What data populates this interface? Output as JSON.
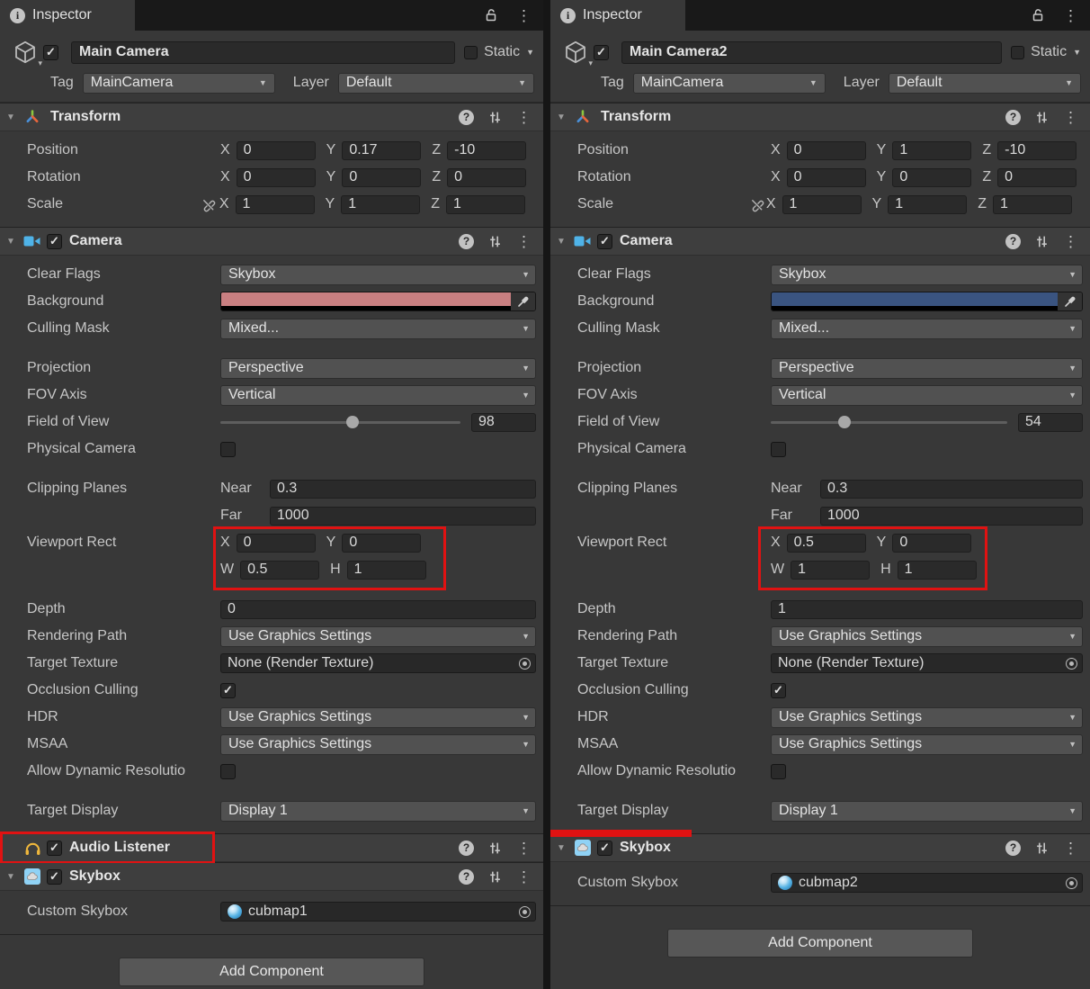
{
  "colors": {
    "highlight_red": "#e01212",
    "panel_background": "#383838",
    "camera1_background_swatch": "#c97f81",
    "camera2_background_swatch": "#3a5480"
  },
  "panels": [
    {
      "tab_title": "Inspector",
      "header": {
        "active": true,
        "name": "Main Camera",
        "static": false,
        "static_label": "Static",
        "tag_label": "Tag",
        "tag_value": "MainCamera",
        "layer_label": "Layer",
        "layer_value": "Default"
      },
      "transform": {
        "title": "Transform",
        "position_label": "Position",
        "rotation_label": "Rotation",
        "scale_label": "Scale",
        "ax": "X",
        "ay": "Y",
        "az": "Z",
        "position": {
          "x": "0",
          "y": "0.17",
          "z": "-10"
        },
        "rotation": {
          "x": "0",
          "y": "0",
          "z": "0"
        },
        "scale": {
          "x": "1",
          "y": "1",
          "z": "1"
        }
      },
      "camera": {
        "title": "Camera",
        "enabled": true,
        "clear_flags_label": "Clear Flags",
        "clear_flags": "Skybox",
        "background_label": "Background",
        "background_color": "#c97f81",
        "culling_mask_label": "Culling Mask",
        "culling_mask": "Mixed...",
        "projection_label": "Projection",
        "projection": "Perspective",
        "fov_axis_label": "FOV Axis",
        "fov_axis": "Vertical",
        "fov_label": "Field of View",
        "fov_value": "98",
        "fov_percent": 55,
        "physical_label": "Physical Camera",
        "physical": false,
        "clipping_label": "Clipping Planes",
        "near_label": "Near",
        "near": "0.3",
        "far_label": "Far",
        "far": "1000",
        "viewport_label": "Viewport Rect",
        "vp_x_label": "X",
        "vp_y_label": "Y",
        "vp_w_label": "W",
        "vp_h_label": "H",
        "vp_x": "0",
        "vp_y": "0",
        "vp_w": "0.5",
        "vp_h": "1",
        "depth_label": "Depth",
        "depth": "0",
        "rendering_path_label": "Rendering Path",
        "rendering_path": "Use Graphics Settings",
        "target_texture_label": "Target Texture",
        "target_texture": "None (Render Texture)",
        "occlusion_label": "Occlusion Culling",
        "occlusion": true,
        "hdr_label": "HDR",
        "hdr": "Use Graphics Settings",
        "msaa_label": "MSAA",
        "msaa": "Use Graphics Settings",
        "allow_dynamic_label": "Allow Dynamic Resolutio",
        "allow_dynamic": false,
        "target_display_label": "Target Display",
        "target_display": "Display 1"
      },
      "audio_listener": {
        "title": "Audio Listener",
        "enabled": true
      },
      "skybox": {
        "title": "Skybox",
        "enabled": true,
        "custom_label": "Custom Skybox",
        "value": "cubmap1"
      },
      "add_component_label": "Add Component"
    },
    {
      "tab_title": "Inspector",
      "header": {
        "active": true,
        "name": "Main Camera2",
        "static": false,
        "static_label": "Static",
        "tag_label": "Tag",
        "tag_value": "MainCamera",
        "layer_label": "Layer",
        "layer_value": "Default"
      },
      "transform": {
        "title": "Transform",
        "position_label": "Position",
        "rotation_label": "Rotation",
        "scale_label": "Scale",
        "ax": "X",
        "ay": "Y",
        "az": "Z",
        "position": {
          "x": "0",
          "y": "1",
          "z": "-10"
        },
        "rotation": {
          "x": "0",
          "y": "0",
          "z": "0"
        },
        "scale": {
          "x": "1",
          "y": "1",
          "z": "1"
        }
      },
      "camera": {
        "title": "Camera",
        "enabled": true,
        "clear_flags_label": "Clear Flags",
        "clear_flags": "Skybox",
        "background_label": "Background",
        "background_color": "#3a5480",
        "culling_mask_label": "Culling Mask",
        "culling_mask": "Mixed...",
        "projection_label": "Projection",
        "projection": "Perspective",
        "fov_axis_label": "FOV Axis",
        "fov_axis": "Vertical",
        "fov_label": "Field of View",
        "fov_value": "54",
        "fov_percent": 31,
        "physical_label": "Physical Camera",
        "physical": false,
        "clipping_label": "Clipping Planes",
        "near_label": "Near",
        "near": "0.3",
        "far_label": "Far",
        "far": "1000",
        "viewport_label": "Viewport Rect",
        "vp_x_label": "X",
        "vp_y_label": "Y",
        "vp_w_label": "W",
        "vp_h_label": "H",
        "vp_x": "0.5",
        "vp_y": "0",
        "vp_w": "1",
        "vp_h": "1",
        "depth_label": "Depth",
        "depth": "1",
        "rendering_path_label": "Rendering Path",
        "rendering_path": "Use Graphics Settings",
        "target_texture_label": "Target Texture",
        "target_texture": "None (Render Texture)",
        "occlusion_label": "Occlusion Culling",
        "occlusion": true,
        "hdr_label": "HDR",
        "hdr": "Use Graphics Settings",
        "msaa_label": "MSAA",
        "msaa": "Use Graphics Settings",
        "allow_dynamic_label": "Allow Dynamic Resolutio",
        "allow_dynamic": false,
        "target_display_label": "Target Display",
        "target_display": "Display 1"
      },
      "skybox": {
        "title": "Skybox",
        "enabled": true,
        "custom_label": "Custom Skybox",
        "value": "cubmap2"
      },
      "add_component_label": "Add Component"
    }
  ]
}
